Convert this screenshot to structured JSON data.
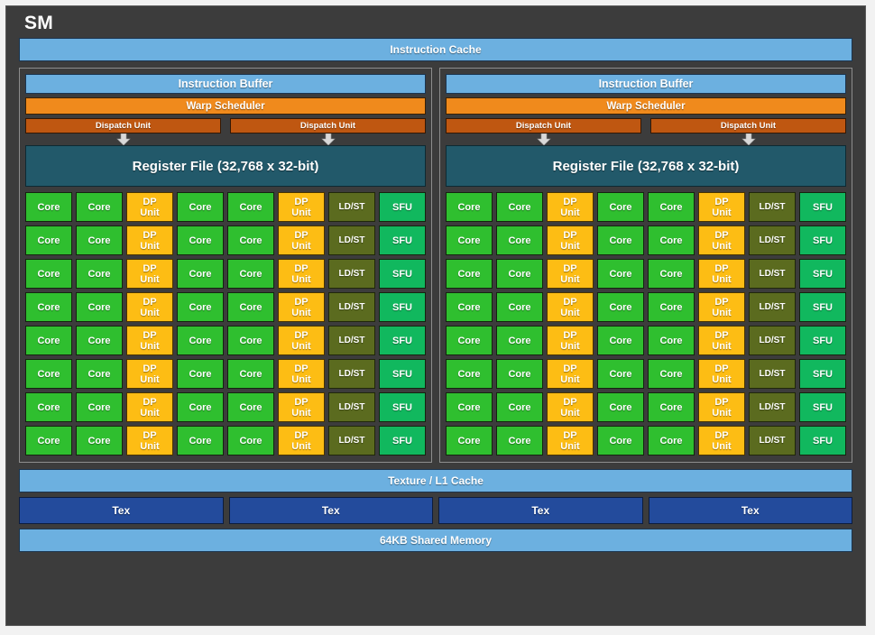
{
  "diagram": {
    "title": "SM",
    "instruction_cache": "Instruction Cache",
    "partitions": [
      {
        "instruction_buffer": "Instruction Buffer",
        "warp_scheduler": "Warp Scheduler",
        "dispatch_units": [
          "Dispatch Unit",
          "Dispatch Unit"
        ],
        "register_file": "Register File (32,768 x 32-bit)"
      },
      {
        "instruction_buffer": "Instruction Buffer",
        "warp_scheduler": "Warp Scheduler",
        "dispatch_units": [
          "Dispatch Unit",
          "Dispatch Unit"
        ],
        "register_file": "Register File (32,768 x 32-bit)"
      }
    ],
    "unit_labels": {
      "core": "Core",
      "dp_line1": "DP",
      "dp_line2": "Unit",
      "ldst": "LD/ST",
      "sfu": "SFU"
    },
    "grid": {
      "rows": 8,
      "columns": 8,
      "column_pattern": [
        "core",
        "core",
        "dp",
        "core",
        "core",
        "dp",
        "ldst",
        "sfu"
      ]
    },
    "texture_l1_cache": "Texture / L1 Cache",
    "tex_units": [
      "Tex",
      "Tex",
      "Tex",
      "Tex"
    ],
    "shared_memory": "64KB Shared Memory",
    "icons": {
      "dispatch_arrow": "down-arrow-icon"
    },
    "colors": {
      "panel_background": "#3c3c3c",
      "page_background": "#f2f2f2",
      "cache_blue": "#6cb0e0",
      "warp_scheduler_orange": "#f08a1c",
      "dispatch_orange": "#bf5711",
      "register_file_teal": "#22596a",
      "core_green": "#2fbf2f",
      "dp_unit_amber": "#fdbd14",
      "ldst_olive": "#5b6b1f",
      "sfu_green": "#11b85e",
      "tex_blue": "#234b9c",
      "partition_border": "#8d8d8d"
    }
  }
}
